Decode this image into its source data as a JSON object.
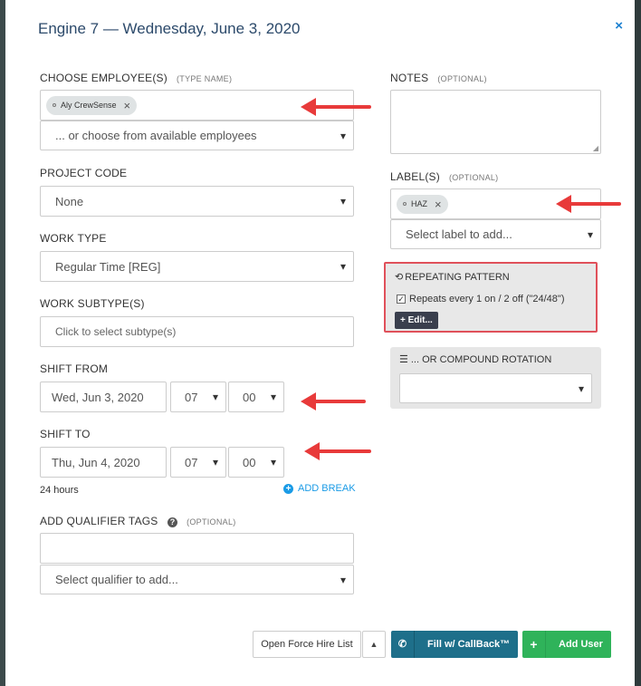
{
  "modal": {
    "title": "Engine 7 — Wednesday, June 3, 2020",
    "close_icon": "×"
  },
  "employees": {
    "label": "CHOOSE EMPLOYEE(S)",
    "hint": "(TYPE NAME)",
    "chip": "Aly CrewSense",
    "select_placeholder": "... or choose from available employees"
  },
  "project_code": {
    "label": "PROJECT CODE",
    "value": "None"
  },
  "work_type": {
    "label": "WORK TYPE",
    "value": "Regular Time [REG]"
  },
  "work_subtypes": {
    "label": "WORK SUBTYPE(S)",
    "placeholder": "Click to select subtype(s)"
  },
  "shift_from": {
    "label": "SHIFT FROM",
    "date": "Wed, Jun 3, 2020",
    "hour": "07",
    "minute": "00"
  },
  "shift_to": {
    "label": "SHIFT TO",
    "date": "Thu, Jun 4, 2020",
    "hour": "07",
    "minute": "00"
  },
  "duration": "24 hours",
  "add_break": "ADD BREAK",
  "qualifier": {
    "label": "ADD QUALIFIER TAGS",
    "hint": "(OPTIONAL)",
    "select_placeholder": "Select qualifier to add..."
  },
  "notes": {
    "label": "NOTES",
    "hint": "(OPTIONAL)"
  },
  "labels": {
    "label": "LABEL(S)",
    "hint": "(OPTIONAL)",
    "chip": "HAZ",
    "select_placeholder": "Select label to add..."
  },
  "repeating": {
    "title": "REPEATING PATTERN",
    "text": "Repeats every 1 on / 2 off (\"24/48\")",
    "edit": "+ Edit..."
  },
  "compound": {
    "title": "... OR COMPOUND ROTATION"
  },
  "footer": {
    "force_hire": "Open Force Hire List",
    "callback": "Fill w/ CallBack™",
    "add_user": "Add User"
  },
  "colors": {
    "title": "#2c4a6b",
    "accent": "#1a7fd0",
    "arrow": "#e83a3a",
    "callback_btn": "#1e6f8a",
    "add_user_btn": "#2fb35a"
  }
}
